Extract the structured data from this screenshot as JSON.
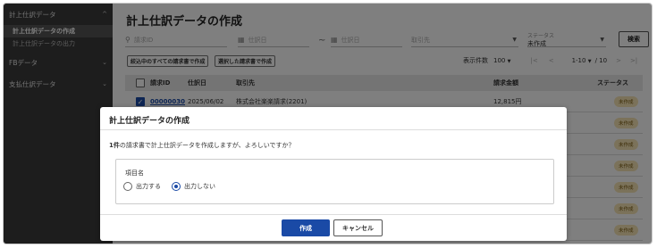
{
  "sidebar": {
    "sections": [
      {
        "label": "計上仕訳データ",
        "chevron": "^"
      },
      {
        "label": "FBデータ",
        "chevron": "v"
      },
      {
        "label": "支払仕訳データ",
        "chevron": "v"
      }
    ],
    "items": [
      {
        "label": "計上仕訳データの作成"
      },
      {
        "label": "計上仕訳データの出力"
      }
    ]
  },
  "page": {
    "title": "計上仕訳データの作成"
  },
  "filters": {
    "request_id_placeholder": "請求ID",
    "date_from_placeholder": "仕訳日",
    "tilde": "~",
    "date_to_placeholder": "仕訳日",
    "partner_placeholder": "取引先",
    "status_label": "ステータス",
    "status_value": "未作成",
    "search_button": "検索"
  },
  "actions": {
    "create_all": "絞込中のすべての請求書で作成",
    "create_selected": "選択した請求書で作成"
  },
  "pager": {
    "per_page_label": "表示件数",
    "per_page_value": "100",
    "range": "1-10",
    "total": "/ 10",
    "first": "|<",
    "prev": "<",
    "next": ">",
    "last": ">|"
  },
  "table": {
    "headers": {
      "request_id": "請求ID",
      "date": "仕訳日",
      "partner": "取引先",
      "amount": "請求金額",
      "status": "ステータス"
    },
    "rows": [
      {
        "request_id": "00000030",
        "date": "2025/06/02",
        "partner": "株式会社楽楽請求(2201)",
        "amount": "12,815円",
        "status": "未作成"
      },
      {
        "status": "未作成"
      },
      {
        "status": "未作成"
      },
      {
        "status": "未作成"
      },
      {
        "status": "未作成"
      },
      {
        "status": "未作成"
      },
      {
        "status": "未作成"
      }
    ]
  },
  "dialog": {
    "title": "計上仕訳データの作成",
    "message_count": "1件",
    "message_rest": "の請求書で計上仕訳データを作成しますが、よろしいですか？",
    "option_label": "項目名",
    "option_output": "出力する",
    "option_no_output": "出力しない",
    "create_button": "作成",
    "cancel_button": "キャンセル"
  },
  "colors": {
    "primary": "#1a4aa6",
    "sidebar_bg": "#3a3a3a",
    "badge_bg": "#f6e4b4"
  }
}
